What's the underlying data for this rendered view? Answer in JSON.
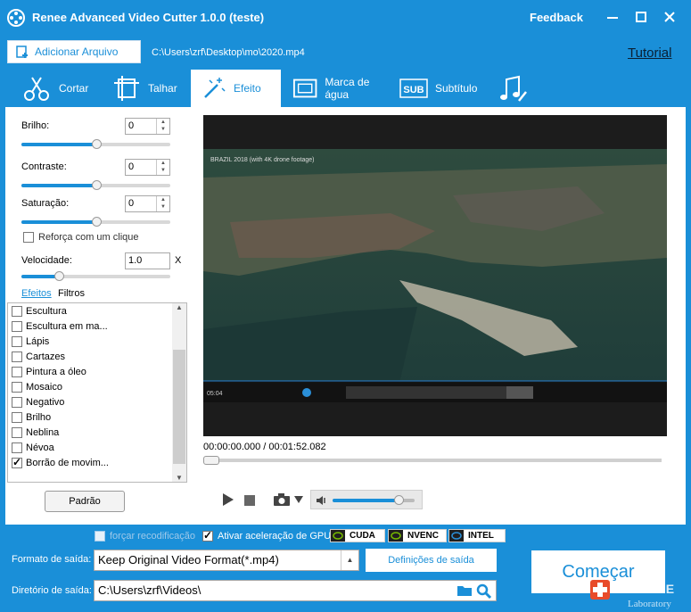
{
  "window": {
    "title": "Renee Advanced Video Cutter 1.0.0 (teste)",
    "feedback": "Feedback"
  },
  "toolbar": {
    "add_file": "Adicionar Arquivo",
    "file_path": "C:\\Users\\zrf\\Desktop\\mo\\2020.mp4",
    "tutorial": "Tutorial"
  },
  "tabs": [
    {
      "label": "Cortar",
      "icon": "scissors-icon"
    },
    {
      "label": "Talhar",
      "icon": "crop-icon"
    },
    {
      "label": "Efeito",
      "icon": "magic-wand-icon",
      "active": true
    },
    {
      "label": "Marca de água",
      "icon": "watermark-icon"
    },
    {
      "label": "Subtítulo",
      "icon": "subtitle-icon"
    },
    {
      "label": "",
      "icon": "music-icon"
    }
  ],
  "adjust": {
    "brightness_label": "Brilho:",
    "brightness_value": "0",
    "brightness_level": 0.5,
    "contrast_label": "Contraste:",
    "contrast_value": "0",
    "contrast_level": 0.5,
    "saturation_label": "Saturação:",
    "saturation_value": "0",
    "saturation_level": 0.5,
    "one_click_label": "Reforça com um clique",
    "one_click_checked": false,
    "speed_label": "Velocidade:",
    "speed_value": "1.0",
    "speed_unit": "X",
    "speed_level": 0.25
  },
  "effects": {
    "tab_effects": "Efeitos",
    "tab_filters": "Filtros",
    "items": [
      {
        "label": "Escultura",
        "checked": false
      },
      {
        "label": "Escultura em ma...",
        "checked": false
      },
      {
        "label": "Lápis",
        "checked": false
      },
      {
        "label": "Cartazes",
        "checked": false
      },
      {
        "label": "Pintura a óleo",
        "checked": false
      },
      {
        "label": "Mosaico",
        "checked": false
      },
      {
        "label": "Negativo",
        "checked": false
      },
      {
        "label": "Brilho",
        "checked": false
      },
      {
        "label": "Neblina",
        "checked": false
      },
      {
        "label": "Névoa",
        "checked": false
      },
      {
        "label": "Borrão de movim...",
        "checked": true
      }
    ],
    "default_button": "Padrão"
  },
  "player": {
    "video_overlay_title": "BRAZIL 2018 (with 4K drone footage)",
    "embedded_time": "05:04",
    "time_display": "00:00:00.000 / 00:01:52.082",
    "progress": 0.0,
    "volume_level": 0.8
  },
  "options": {
    "force_reencode": "forçar recodificação",
    "force_reencode_checked": false,
    "gpu_accel": "Ativar aceleração de GPU",
    "gpu_accel_checked": true,
    "gpu_badges": [
      "CUDA",
      "NVENC",
      "INTEL"
    ]
  },
  "output": {
    "format_label": "Formato de saída:",
    "format_value": "Keep Original Video Format(*.mp4)",
    "settings_button": "Definições de saída",
    "dir_label": "Diretório de saída:",
    "dir_value": "C:\\Users\\zrf\\Videos\\",
    "start_button": "Começar"
  },
  "brand": {
    "logo_text": "RENE.E",
    "logo_sub": "Laboratory"
  },
  "colors": {
    "accent": "#1a8fd8",
    "white": "#ffffff"
  }
}
